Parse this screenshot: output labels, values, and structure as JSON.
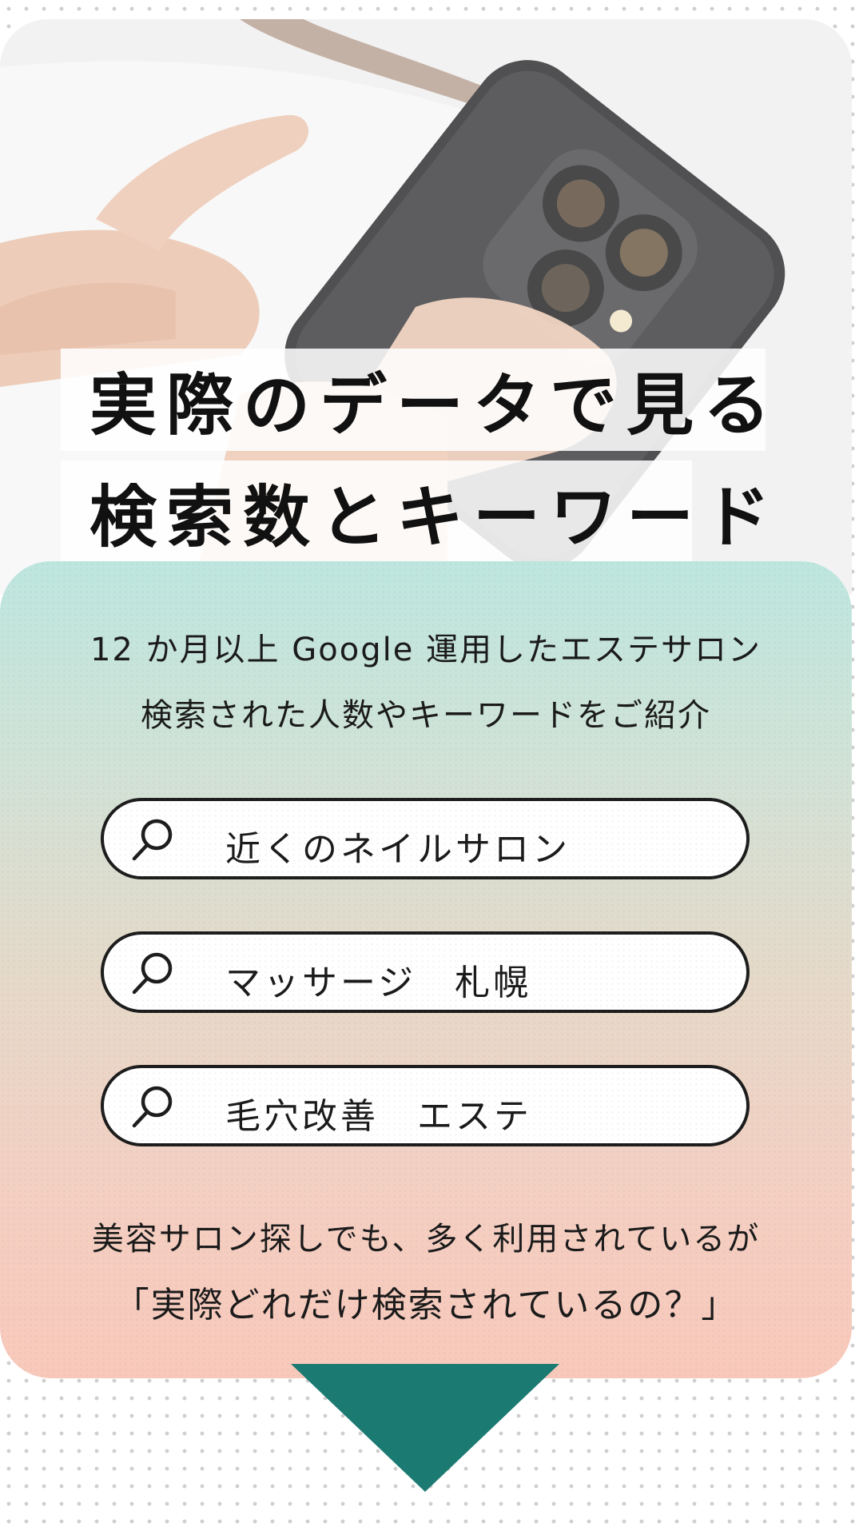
{
  "hero": {
    "title_line1": "実際のデータで見る",
    "title_line2": "検索数とキーワード"
  },
  "intro": {
    "line1": "12 か月以上 Google 運用したエステサロン",
    "line2": "検索された人数やキーワードをご紹介"
  },
  "searches": [
    {
      "icon": "search-icon",
      "query": "近くのネイルサロン"
    },
    {
      "icon": "search-icon",
      "query": "マッサージ　札幌"
    },
    {
      "icon": "search-icon",
      "query": "毛穴改善　エステ"
    }
  ],
  "outro": {
    "line1": "美容サロン探しでも、多く利用されているが",
    "line2": "「実際どれだけ検索されているの？」"
  },
  "colors": {
    "panel_top": "#bde6df",
    "panel_bottom": "#f8c9bb",
    "arrow": "#1b7a72",
    "text": "#1a1a1a"
  }
}
